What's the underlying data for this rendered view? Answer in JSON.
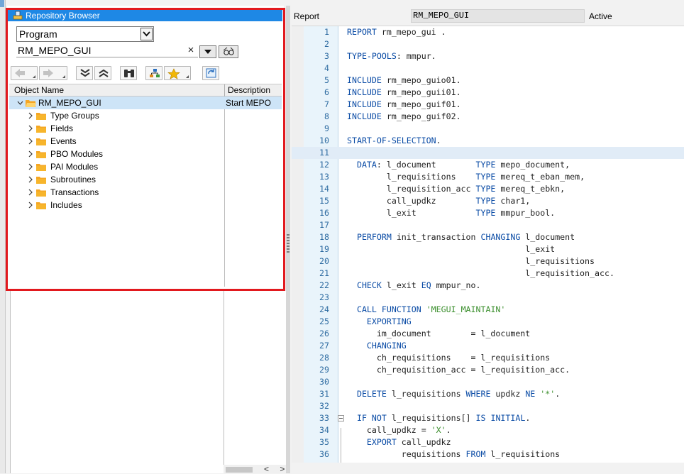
{
  "repository_browser": {
    "title": "Repository Browser",
    "object_type": "Program",
    "object_name": "RM_MEPO_GUI",
    "clear_symbol": "×",
    "columns": {
      "object_name": "Object Name",
      "description": "Description"
    },
    "root": {
      "label": "RM_MEPO_GUI",
      "description": "Start MEPO"
    },
    "nodes": [
      {
        "label": "Type Groups"
      },
      {
        "label": "Fields"
      },
      {
        "label": "Events"
      },
      {
        "label": "PBO Modules"
      },
      {
        "label": "PAI Modules"
      },
      {
        "label": "Subroutines"
      },
      {
        "label": "Transactions"
      },
      {
        "label": "Includes"
      }
    ],
    "toolbar_icons": [
      "back-arrow-icon",
      "forward-arrow-icon",
      "collapse-all-icon",
      "expand-all-icon",
      "binoculars-icon",
      "hierarchy-icon",
      "favorites-star-icon",
      "refresh-icon"
    ],
    "highlight_color": "#e2191e",
    "title_color": "#1e88e5"
  },
  "editor": {
    "type_label": "Report",
    "program_name": "RM_MEPO_GUI",
    "status": "Active",
    "current_line": 11,
    "lines": [
      {
        "n": "1",
        "t": "REPORT rm_mepo_gui ."
      },
      {
        "n": "2",
        "t": ""
      },
      {
        "n": "3",
        "t": "TYPE-POOLS: mmpur."
      },
      {
        "n": "4",
        "t": ""
      },
      {
        "n": "5",
        "t": "INCLUDE rm_mepo_guio01."
      },
      {
        "n": "6",
        "t": "INCLUDE rm_mepo_guii01."
      },
      {
        "n": "7",
        "t": "INCLUDE rm_mepo_guif01."
      },
      {
        "n": "8",
        "t": "INCLUDE rm_mepo_guif02."
      },
      {
        "n": "9",
        "t": ""
      },
      {
        "n": "10",
        "t": "START-OF-SELECTION."
      },
      {
        "n": "11",
        "t": ""
      },
      {
        "n": "12",
        "t": "  DATA: l_document        TYPE mepo_document,"
      },
      {
        "n": "13",
        "t": "        l_requisitions    TYPE mereq_t_eban_mem,"
      },
      {
        "n": "14",
        "t": "        l_requisition_acc TYPE mereq_t_ebkn,"
      },
      {
        "n": "15",
        "t": "        call_updkz        TYPE char1,"
      },
      {
        "n": "16",
        "t": "        l_exit            TYPE mmpur_bool."
      },
      {
        "n": "17",
        "t": ""
      },
      {
        "n": "18",
        "t": "  PERFORM init_transaction CHANGING l_document"
      },
      {
        "n": "19",
        "t": "                                    l_exit"
      },
      {
        "n": "20",
        "t": "                                    l_requisitions"
      },
      {
        "n": "21",
        "t": "                                    l_requisition_acc."
      },
      {
        "n": "22",
        "t": "  CHECK l_exit EQ mmpur_no."
      },
      {
        "n": "23",
        "t": ""
      },
      {
        "n": "24",
        "t": "  CALL FUNCTION 'MEGUI_MAINTAIN'"
      },
      {
        "n": "25",
        "t": "    EXPORTING"
      },
      {
        "n": "26",
        "t": "      im_document        = l_document"
      },
      {
        "n": "27",
        "t": "    CHANGING"
      },
      {
        "n": "28",
        "t": "      ch_requisitions    = l_requisitions"
      },
      {
        "n": "29",
        "t": "      ch_requisition_acc = l_requisition_acc."
      },
      {
        "n": "30",
        "t": ""
      },
      {
        "n": "31",
        "t": "  DELETE l_requisitions WHERE updkz NE '*'."
      },
      {
        "n": "32",
        "t": ""
      },
      {
        "n": "33",
        "t": "  IF NOT l_requisitions[] IS INITIAL."
      },
      {
        "n": "34",
        "t": "    call_updkz = 'X'."
      },
      {
        "n": "35",
        "t": "    EXPORT call_updkz"
      },
      {
        "n": "36",
        "t": "           requisitions FROM l_requisitions"
      }
    ],
    "keyword_color": "#0a4ba5",
    "string_color": "#3c8f2e"
  },
  "bottom_scroll": {
    "arrows": "< >"
  }
}
